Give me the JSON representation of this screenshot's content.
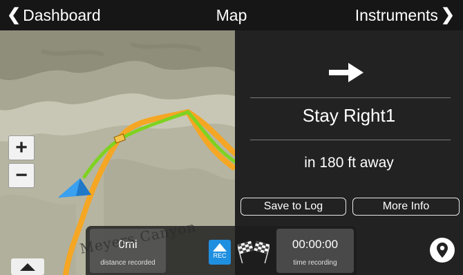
{
  "header": {
    "back_label": "Dashboard",
    "title": "Map",
    "forward_label": "Instruments"
  },
  "map": {
    "zoom_in_label": "+",
    "zoom_out_label": "−",
    "place_label": "Meyers Canyon",
    "route_colors": {
      "track": "#f5a623",
      "recorded": "#7ed321"
    },
    "terrain_color": "#b9b7a4"
  },
  "navigation": {
    "direction_icon": "right-arrow-icon",
    "instruction": "Stay Right1",
    "distance_text": "in 180 ft away",
    "save_label": "Save to Log",
    "more_info_label": "More Info"
  },
  "stats": {
    "distance_value": "0mi",
    "distance_label": "distance recorded",
    "rec_label": "REC",
    "time_value": "00:00:00",
    "time_label": "time recording"
  },
  "colors": {
    "accent_blue": "#1f8fe0",
    "panel_bg": "#222222"
  }
}
